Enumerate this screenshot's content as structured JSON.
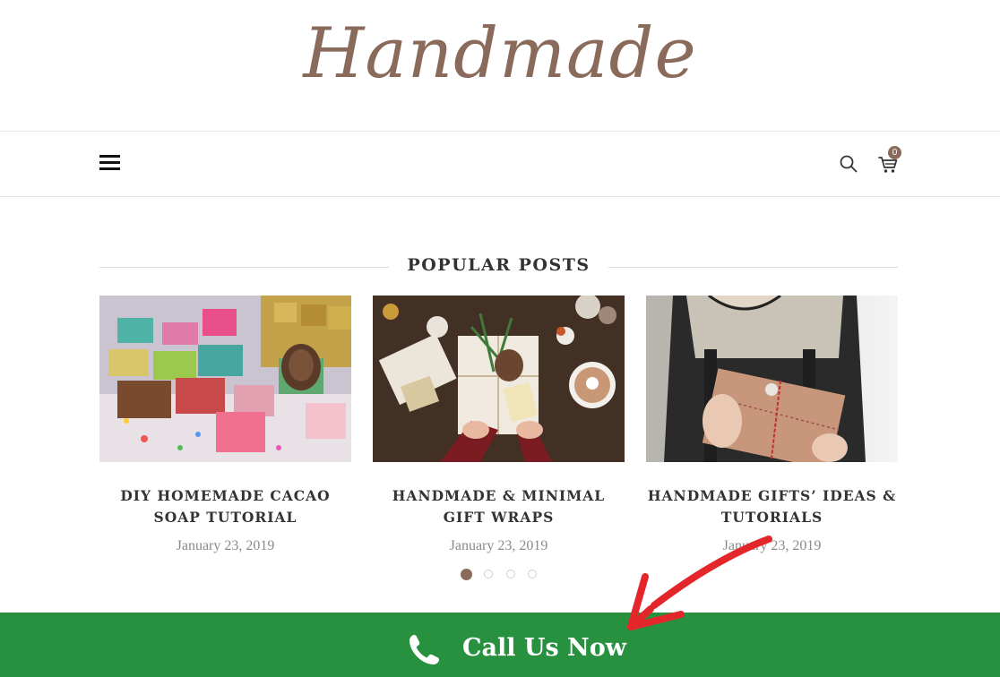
{
  "header": {
    "logo_text": "Handmade"
  },
  "nav": {
    "cart_count": "0"
  },
  "popular": {
    "title": "POPULAR POSTS",
    "posts": [
      {
        "title": "DIY HOMEMADE CACAO SOAP TUTORIAL",
        "date": "January 23, 2019"
      },
      {
        "title": "HANDMADE & MINIMAL GIFT WRAPS",
        "date": "January 23, 2019"
      },
      {
        "title": "HANDMADE GIFTS’ IDEAS & TUTORIALS",
        "date": "January 23, 2019"
      }
    ],
    "pagination": {
      "pages": 4,
      "active": 1
    }
  },
  "cta": {
    "label": "Call Us Now",
    "color": "#27913f"
  },
  "colors": {
    "brand": "#8a6a5a",
    "annotation_arrow": "#e3262a"
  }
}
